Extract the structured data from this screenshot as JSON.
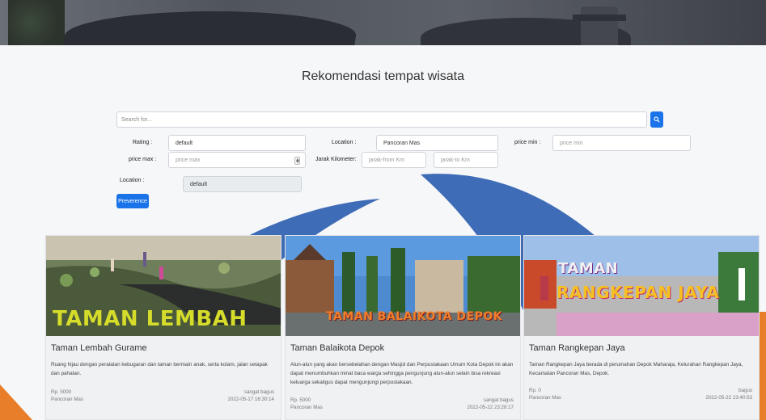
{
  "page": {
    "title": "Rekomendasi tempat wisata"
  },
  "search": {
    "placeholder": "Search for..."
  },
  "filters": {
    "rating_label": "Rating :",
    "rating_value": "default",
    "location_label": "Location :",
    "location_value": "Pancoran Mas",
    "price_min_label": "price min :",
    "price_min_placeholder": "price min",
    "price_max_label": "price max :",
    "price_max_placeholder": "price max",
    "distance_label": "Jarak Kilometer:",
    "distance_from_placeholder": "jarak-from Km",
    "distance_to_placeholder": "jarak-to Km",
    "location2_label": "Location :",
    "location2_value": "default",
    "preference_button": "Preverence"
  },
  "cards": [
    {
      "title": "Taman Lembah Gurame",
      "description": "Ruang hijau dengan peralatan kebugaran dan taman bermain anak, serta kolam, jalan setapak dan pahatan.",
      "price": "Rp. 5000",
      "location": "Pancoran Mas",
      "rating": "sangat bagus",
      "date": "2022-05-17 16:30:14",
      "sign": "TAMAN LEMBAH"
    },
    {
      "title": "Taman Balaikota Depok",
      "description": "Alun-alun yang akan bersebelahan dengan Masjid dan Perpustakaan Umum Kota Depok ini akan dapat menumbuhkan minat baca warga sehingga pengunjung alun-alun selain bisa rekreasi keluarga sekaligus dapat mengunjungi perpustakaan.",
      "price": "Rp. 5000",
      "location": "Pancoran Mas",
      "rating": "sangat bagus",
      "date": "2022-05-22 23:28:17",
      "sign": "TAMAN BALAIKOTA DEPOK"
    },
    {
      "title": "Taman Rangkepan Jaya",
      "description": "Taman Rangkepan Jaya berada di perumahan Depok Maharaja, Kelurahan Rangkepan Jaya, Kecamatan Pancoran Mas, Depok.",
      "price": "Rp. 0",
      "location": "Pancoran Mas",
      "rating": "bagus",
      "date": "2022-05-22 23:40:53",
      "sign_top": "TAMAN",
      "sign_bottom": "RANGKEPAN JAYA"
    }
  ],
  "colors": {
    "primary": "#1a73e8",
    "watermark_blue": "#2f5fb0",
    "watermark_orange": "#e8771f"
  }
}
